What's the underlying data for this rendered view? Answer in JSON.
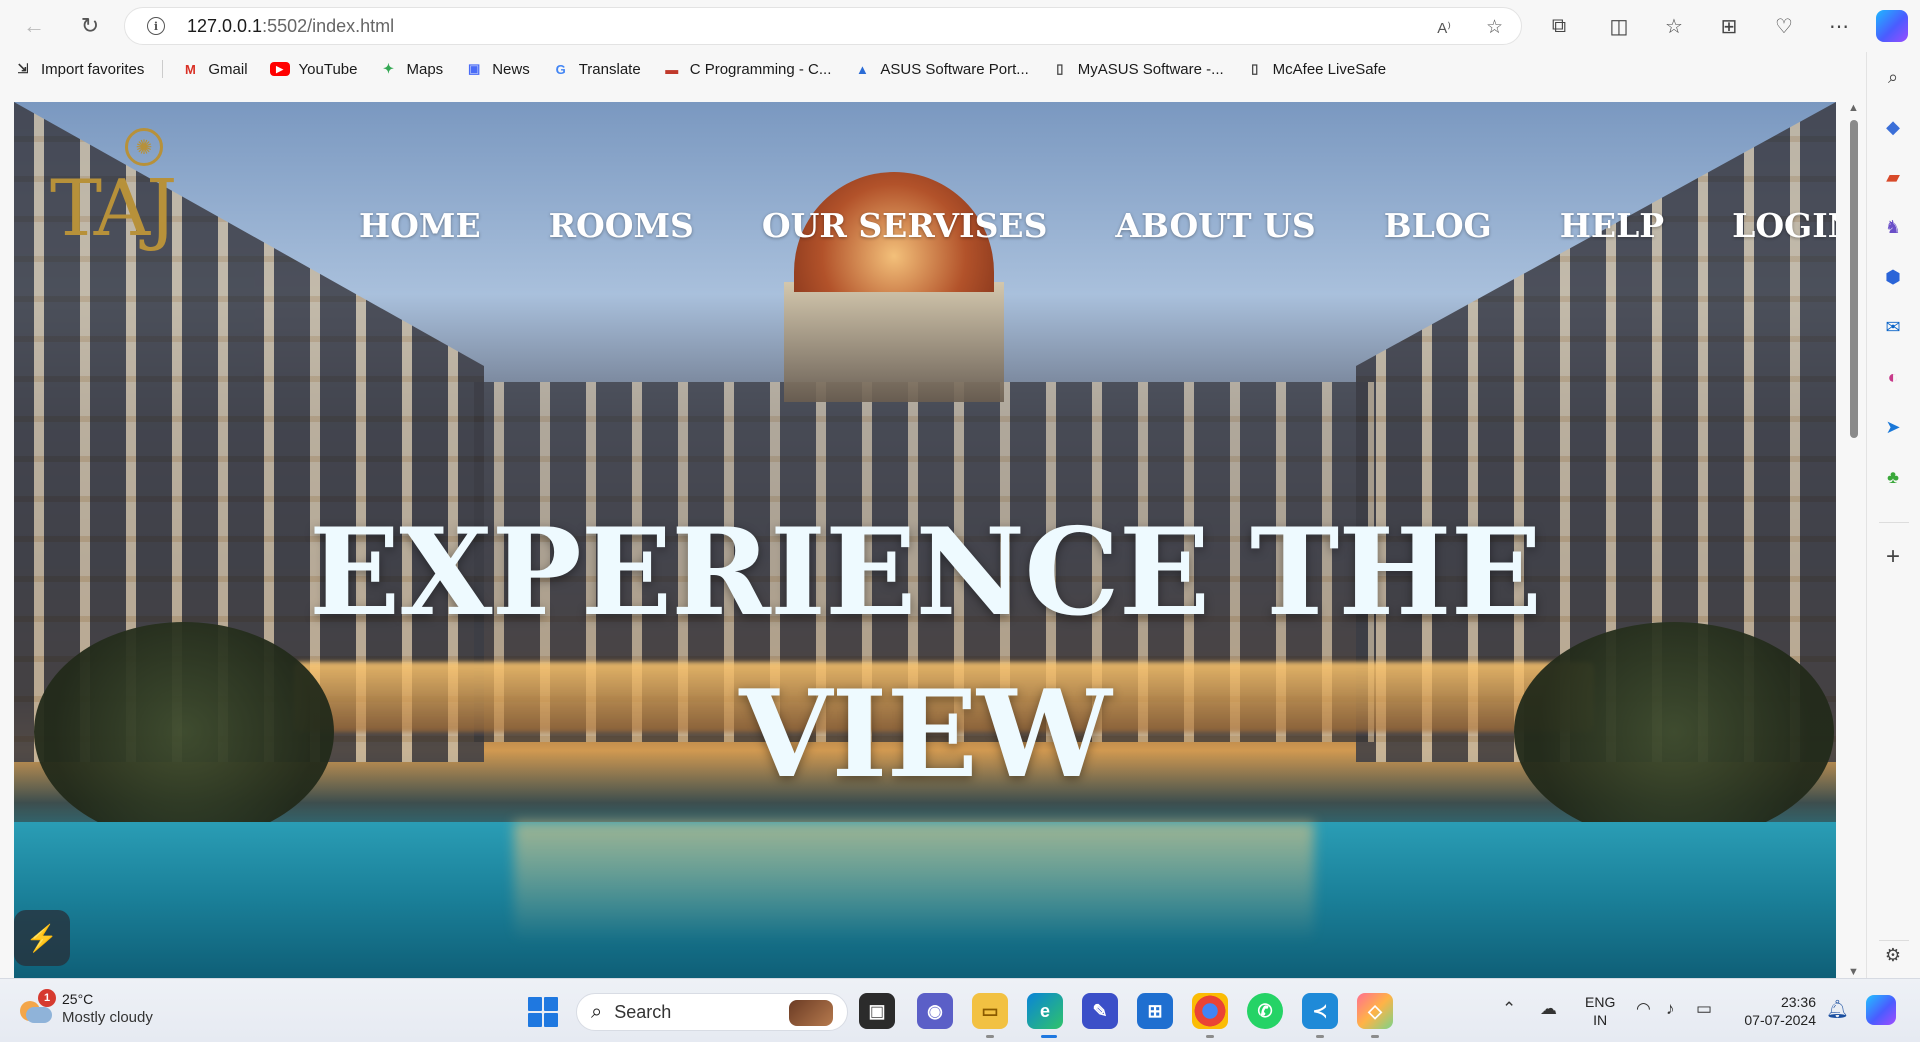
{
  "browser": {
    "url_host": "127.0.0.1",
    "url_path": ":5502/index.html",
    "favorites": [
      {
        "label": "Import favorites",
        "icon": "import-icon",
        "color": "#333333"
      },
      {
        "label": "Gmail",
        "icon": "gmail-icon",
        "color": "#d93025"
      },
      {
        "label": "YouTube",
        "icon": "youtube-icon",
        "color": "#ff0000"
      },
      {
        "label": "Maps",
        "icon": "maps-icon",
        "color": "#34a853"
      },
      {
        "label": "News",
        "icon": "news-icon",
        "color": "#4a6cf7"
      },
      {
        "label": "Translate",
        "icon": "translate-icon",
        "color": "#4285f4"
      },
      {
        "label": "C Programming - C...",
        "icon": "site-icon",
        "color": "#c0392b"
      },
      {
        "label": "ASUS Software Port...",
        "icon": "asus-icon",
        "color": "#2b6cd6"
      },
      {
        "label": "MyASUS Software -...",
        "icon": "page-icon",
        "color": "#444444"
      },
      {
        "label": "McAfee LiveSafe",
        "icon": "page-icon",
        "color": "#444444"
      }
    ]
  },
  "site": {
    "logo_text": "TAJ",
    "nav": {
      "home": "HOME",
      "rooms": "ROOMS",
      "services": "OUR SERVISES",
      "about": "ABOUT US",
      "blog": "BLOG",
      "help": "HELP",
      "login": "LOGIN"
    },
    "hero": {
      "line1": "EXPERIENCE THE",
      "line2": "VIEW"
    }
  },
  "taskbar": {
    "weather_temp": "25°C",
    "weather_desc": "Mostly cloudy",
    "weather_badge": "1",
    "search_placeholder": "Search",
    "lang_line1": "ENG",
    "lang_line2": "IN",
    "time": "23:36",
    "date": "07-07-2024"
  },
  "colors": {
    "logo_gold": "#b7913a",
    "nav_text": "#ffffff",
    "hero_text": "#eefaff"
  }
}
